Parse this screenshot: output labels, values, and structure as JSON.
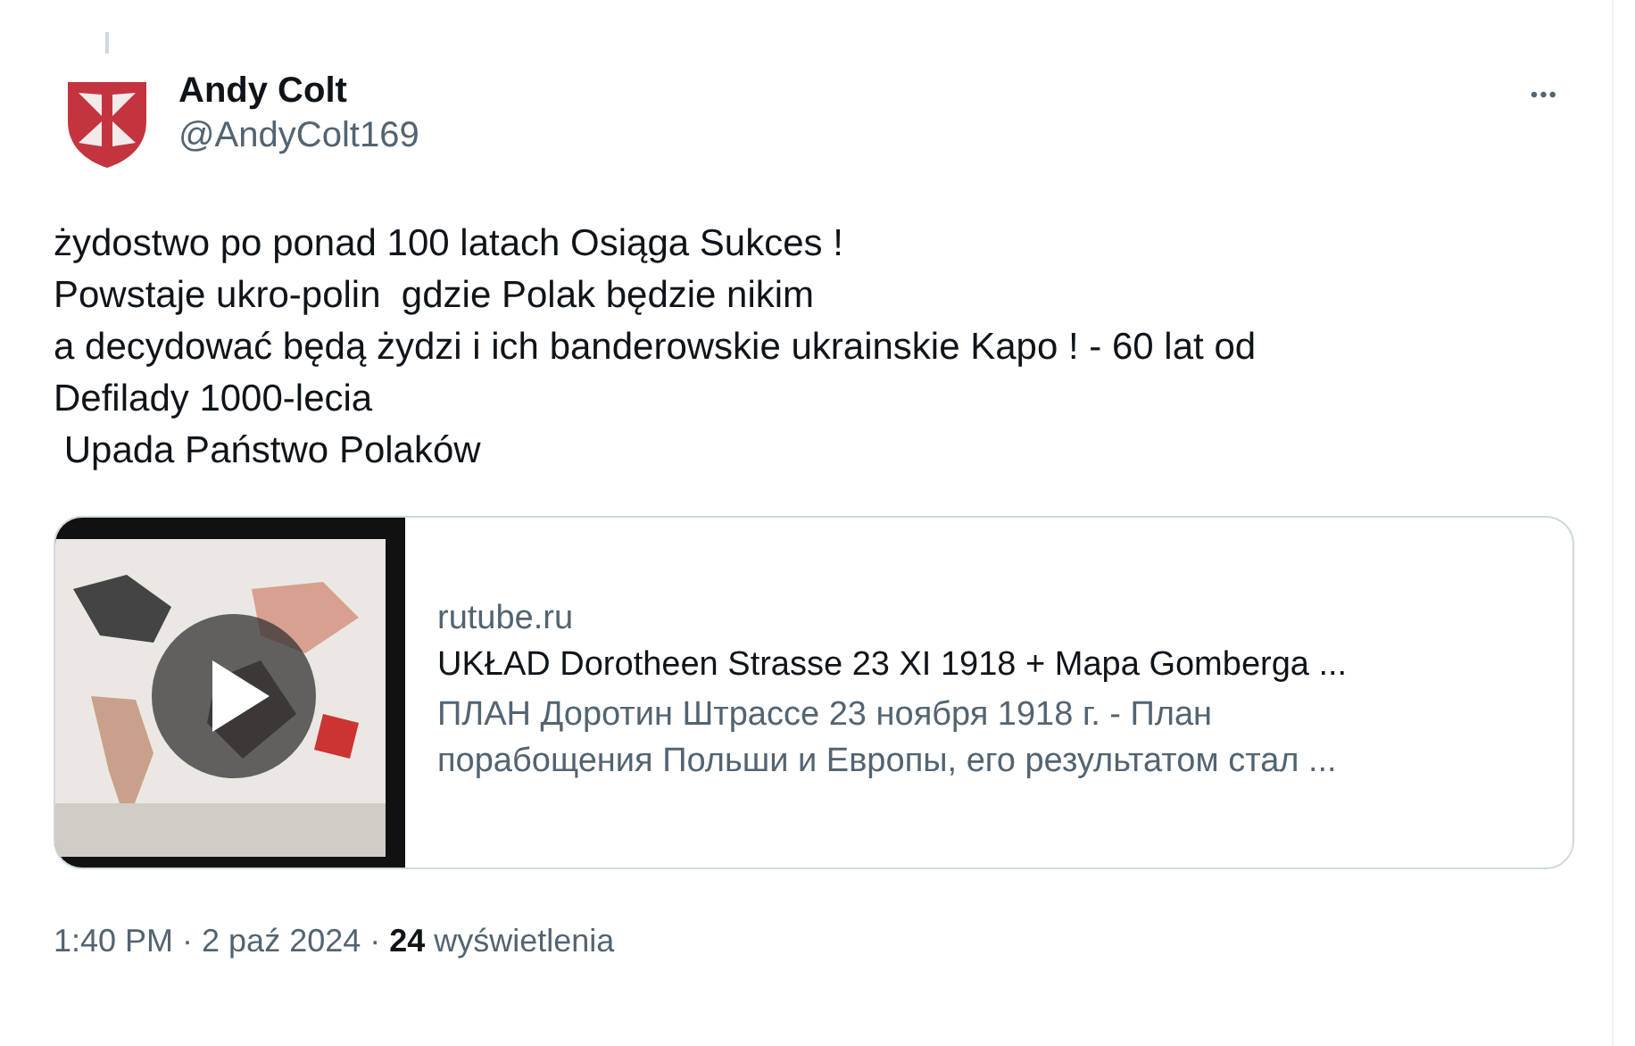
{
  "author": {
    "name": "Andy Colt",
    "handle": "@AndyColt169"
  },
  "more_button": "•••",
  "text": "żydostwo po ponad 100 latach Osiąga Sukces !\nPowstaje ukro-polin  gdzie Polak będzie nikim\na decydować będą żydzi i ich banderowskie ukrainskie Kapo ! - 60 lat od\nDefilady 1000-lecia\n Upada Państwo Polaków",
  "link_card": {
    "domain": "rutube.ru",
    "title": "UKŁAD Dorotheen Strasse 23 XI 1918 + Mapa Gomberga ...",
    "description": "ПЛАН Доротин Штрассе 23 ноября 1918 г. - План\nпорабощения Польши и Европы, его результатом стал ..."
  },
  "meta": "1:40 PM · 2 paź 2024 · **24** wyświetlenia"
}
